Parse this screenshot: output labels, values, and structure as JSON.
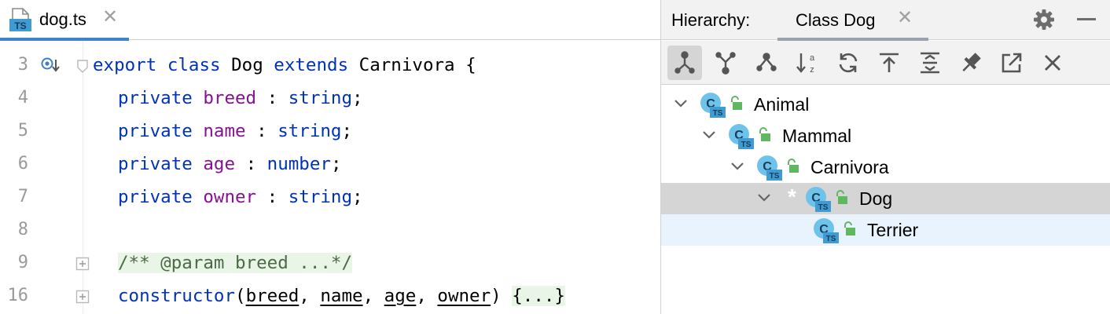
{
  "editor": {
    "file_tab": {
      "name": "dog.ts",
      "close": "✕",
      "icon_label": "TS"
    },
    "line_numbers": [
      "3",
      "4",
      "5",
      "6",
      "7",
      "8",
      "9",
      "16"
    ],
    "code": {
      "l3_export": "export",
      "l3_class": "class",
      "l3_name": "Dog",
      "l3_extends": "extends",
      "l3_base": "Carnivora",
      "l3_brace": "{",
      "private": "private",
      "l4_field": "breed",
      "l4_type": "string",
      "l5_field": "name",
      "l5_type": "string",
      "l6_field": "age",
      "l6_type": "number",
      "l7_field": "owner",
      "l7_type": "string",
      "colon": ":",
      "semi": ";",
      "l9_comment": "/** @param breed ...*/",
      "l16_ctor": "constructor",
      "l16_open": "(",
      "l16_params": [
        "breed",
        "name",
        "age",
        "owner"
      ],
      "comma": ",",
      "l16_close": ")",
      "l16_body": "{...}"
    }
  },
  "panel": {
    "title": "Hierarchy:",
    "tab_label": "Class Dog",
    "tab_close": "✕",
    "toolbar": [
      "subtypes-hierarchy-icon",
      "supertypes-hierarchy-icon",
      "class-hierarchy-icon",
      "sort-alphabetically-icon",
      "refresh-icon",
      "scope-up-icon",
      "expand-all-icon",
      "pin-icon",
      "open-in-new-window-icon",
      "close-icon"
    ],
    "tree": [
      {
        "label": "Animal",
        "marked": ""
      },
      {
        "label": "Mammal",
        "marked": ""
      },
      {
        "label": "Carnivora",
        "marked": ""
      },
      {
        "label": "Dog",
        "marked": "*"
      },
      {
        "label": "Terrier",
        "marked": ""
      }
    ],
    "icon_label": "TS"
  },
  "colors": {
    "keyword": "#0033b3",
    "field": "#871094",
    "comment": "#4a6b46",
    "accent": "#4083c9",
    "selection": "#d5d5d5",
    "focus": "#e8f3fd"
  }
}
